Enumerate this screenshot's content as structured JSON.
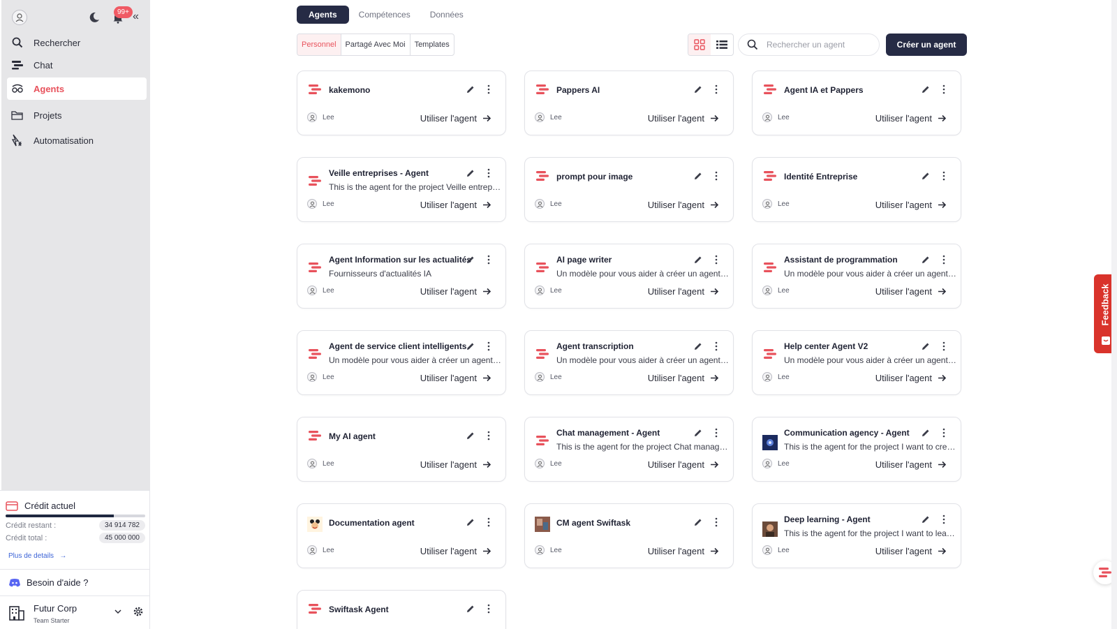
{
  "sidebar": {
    "notifications_badge": "99+",
    "collapse_glyph": "«",
    "nav": [
      {
        "label": "Rechercher",
        "icon": "search-icon"
      },
      {
        "label": "Chat",
        "icon": "chat-icon"
      },
      {
        "label": "Agents",
        "icon": "agents-icon",
        "active": true
      },
      {
        "label": "Projets",
        "icon": "folder-icon"
      },
      {
        "label": "Automatisation",
        "icon": "automation-icon"
      }
    ],
    "credit": {
      "title": "Crédit actuel",
      "remaining_label": "Crédit restant :",
      "remaining_value": "34 914 782",
      "total_label": "Crédit total :",
      "total_value": "45 000 000",
      "used_fraction": 0.776,
      "more_link": "Plus de details"
    },
    "help_label": "Besoin d'aide ?",
    "org": {
      "name": "Futur Corp",
      "plan": "Team Starter"
    }
  },
  "main": {
    "tabs": [
      "Agents",
      "Compétences",
      "Données"
    ],
    "subtabs": [
      "Personnel",
      "Partagé Avec Moi",
      "Templates"
    ],
    "search_placeholder": "Rechercher un agent",
    "create_button": "Créer un agent",
    "use_label": "Utiliser l'agent",
    "owner_name": "Lee"
  },
  "agents": [
    {
      "title": "kakemono",
      "desc": "",
      "icon": "swiftask-logo"
    },
    {
      "title": "Pappers AI",
      "desc": "",
      "icon": "swiftask-logo"
    },
    {
      "title": "Agent IA et Pappers",
      "desc": "",
      "icon": "swiftask-logo"
    },
    {
      "title": "Veille entreprises - Agent",
      "desc": "This is the agent for the project Veille entrepris...",
      "icon": "swiftask-logo"
    },
    {
      "title": "prompt pour image",
      "desc": "",
      "icon": "swiftask-logo"
    },
    {
      "title": "Identité Entreprise",
      "desc": "",
      "icon": "swiftask-logo"
    },
    {
      "title": "Agent Information sur les actualités",
      "desc": "Fournisseurs d'actualités IA",
      "icon": "swiftask-logo"
    },
    {
      "title": "AI page writer",
      "desc": "Un modèle pour vous aider à créer un agent IA...",
      "icon": "swiftask-logo"
    },
    {
      "title": "Assistant de programmation",
      "desc": "Un modèle pour vous aider à créer un agent IA...",
      "icon": "swiftask-logo"
    },
    {
      "title": "Agent de service client intelligents",
      "desc": "Un modèle pour vous aider à créer un agent IA...",
      "icon": "swiftask-logo"
    },
    {
      "title": "Agent transcription",
      "desc": "Un modèle pour vous aider à créer un agent IA...",
      "icon": "swiftask-logo"
    },
    {
      "title": "Help center Agent V2",
      "desc": "Un modèle pour vous aider à créer un agent IA...",
      "icon": "swiftask-logo"
    },
    {
      "title": "My AI agent",
      "desc": "",
      "icon": "swiftask-logo"
    },
    {
      "title": "Chat management - Agent",
      "desc": "This is the agent for the project Chat manage...",
      "icon": "swiftask-logo"
    },
    {
      "title": "Communication agency - Agent",
      "desc": "This is the agent for the project I want to creat...",
      "icon": "image-thumb-blue"
    },
    {
      "title": "Documentation agent",
      "desc": "",
      "icon": "image-thumb-cartoon"
    },
    {
      "title": "CM agent Swiftask",
      "desc": "",
      "icon": "image-thumb-photo"
    },
    {
      "title": "Deep learning - Agent",
      "desc": "This is the agent for the project I want to learn ...",
      "icon": "image-thumb-portrait"
    },
    {
      "title": "Swiftask Agent",
      "desc": "",
      "icon": "swiftask-logo"
    }
  ],
  "feedback_label": "Feedback",
  "colors": {
    "accent": "#e8525c",
    "primary": "#262b45",
    "feedback": "#d9332b"
  }
}
